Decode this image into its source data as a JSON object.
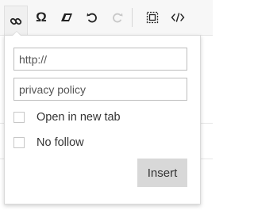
{
  "toolbar": {
    "buttons": [
      {
        "name": "link-icon",
        "state": "active"
      },
      {
        "name": "omega-icon",
        "glyph": "Ω",
        "state": "normal"
      },
      {
        "name": "eraser-icon",
        "state": "normal"
      },
      {
        "name": "undo-icon",
        "state": "normal"
      },
      {
        "name": "redo-icon",
        "state": "disabled"
      },
      {
        "name": "select-all-icon",
        "state": "normal"
      },
      {
        "name": "code-icon",
        "state": "normal"
      }
    ]
  },
  "link_popup": {
    "url_placeholder": "http://",
    "url_value": "",
    "text_value": "privacy policy",
    "open_new_tab_label": "Open in new tab",
    "open_new_tab_checked": false,
    "no_follow_label": "No follow",
    "no_follow_checked": false,
    "insert_label": "Insert"
  },
  "colors": {
    "toolbar_bg": "#f7f7f7",
    "button_bg": "#d8d8d8",
    "disabled_icon": "#c8c8c8"
  }
}
